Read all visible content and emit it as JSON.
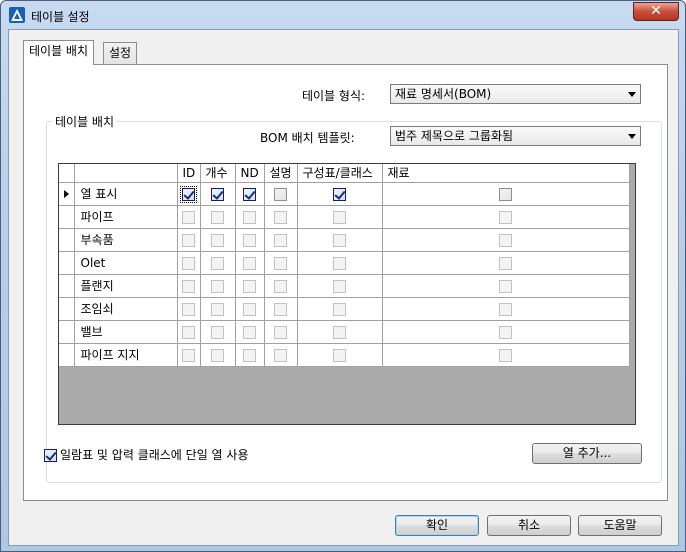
{
  "window": {
    "title": "테이블 설정",
    "close_symbol": "✕"
  },
  "tabs": [
    {
      "label": "테이블 배치",
      "active": true
    },
    {
      "label": "설정",
      "active": false
    }
  ],
  "table_format": {
    "label": "테이블 형식:",
    "value": "재료 명세서(BOM)"
  },
  "group": {
    "title": "테이블 배치"
  },
  "bom_template": {
    "label": "BOM 배치 템플릿:",
    "value": "범주 제목으로 그룹화됨"
  },
  "grid": {
    "columns": [
      "ID",
      "개수",
      "ND",
      "설명",
      "구성표/클래스",
      "재료"
    ],
    "rows": [
      {
        "label": "열 표시",
        "selected": true,
        "checks": [
          true,
          true,
          true,
          false,
          true,
          false
        ]
      },
      {
        "label": "파이프",
        "selected": false,
        "checks": [
          false,
          false,
          false,
          false,
          false,
          false
        ]
      },
      {
        "label": "부속품",
        "selected": false,
        "checks": [
          false,
          false,
          false,
          false,
          false,
          false
        ]
      },
      {
        "label": "Olet",
        "selected": false,
        "checks": [
          false,
          false,
          false,
          false,
          false,
          false
        ]
      },
      {
        "label": "플랜지",
        "selected": false,
        "checks": [
          false,
          false,
          false,
          false,
          false,
          false
        ]
      },
      {
        "label": "조임쇠",
        "selected": false,
        "checks": [
          false,
          false,
          false,
          false,
          false,
          false
        ]
      },
      {
        "label": "밸브",
        "selected": false,
        "checks": [
          false,
          false,
          false,
          false,
          false,
          false
        ]
      },
      {
        "label": "파이프 지지",
        "selected": false,
        "checks": [
          false,
          false,
          false,
          false,
          false,
          false
        ]
      }
    ]
  },
  "single_column_option": {
    "label": "일람표 및 압력 클래스에 단일 열 사용",
    "checked": true
  },
  "buttons": {
    "add_column": "열 추가...",
    "ok": "확인",
    "cancel": "취소",
    "help": "도움말"
  }
}
